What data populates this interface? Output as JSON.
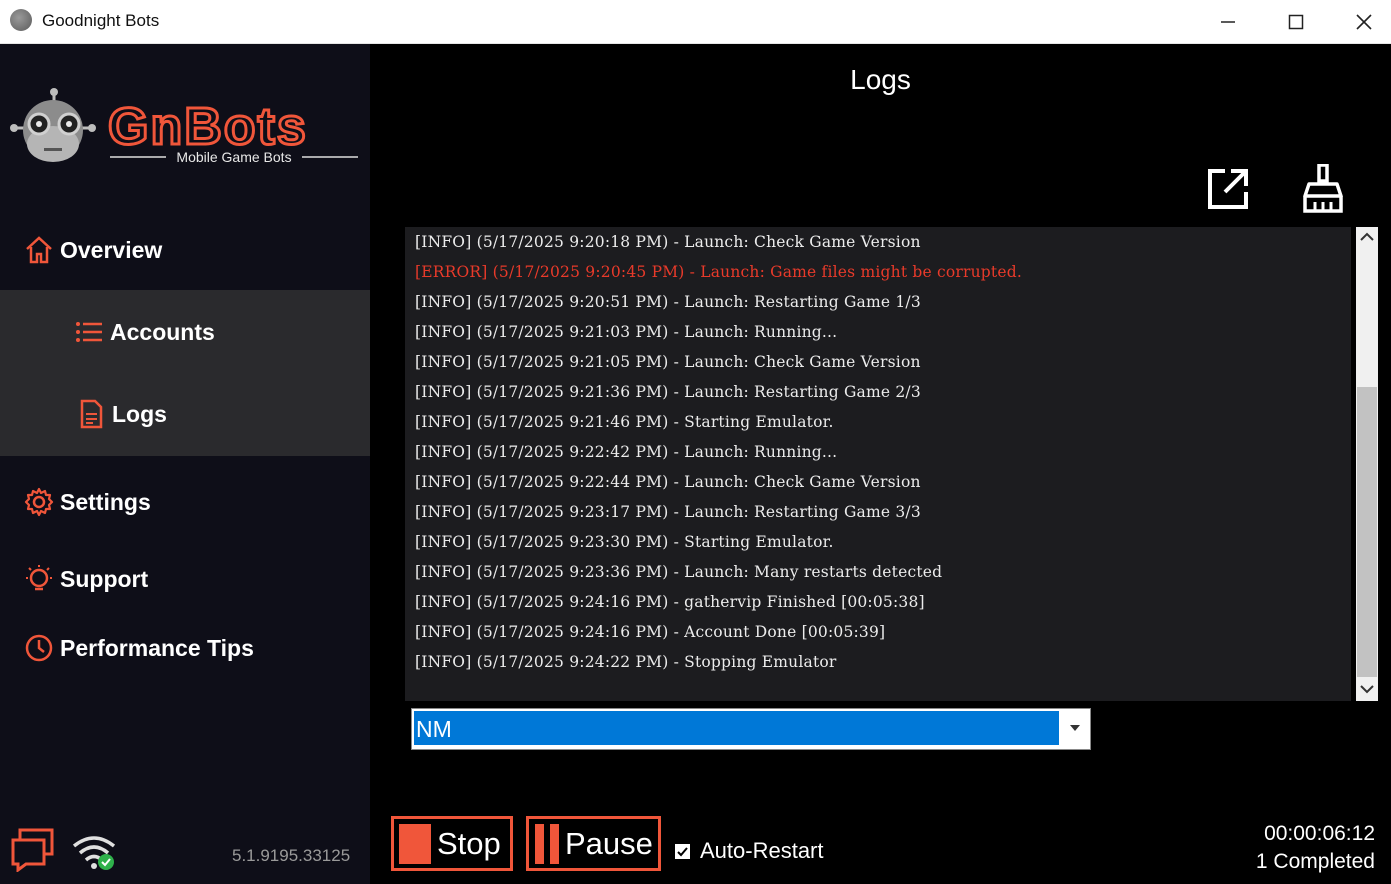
{
  "window": {
    "title": "Goodnight Bots"
  },
  "logo": {
    "name": "GnBots",
    "tagline": "Mobile Game Bots"
  },
  "nav": {
    "overview": "Overview",
    "accounts": "Accounts",
    "logs": "Logs",
    "settings": "Settings",
    "support": "Support",
    "performance_tips": "Performance Tips"
  },
  "main": {
    "title": "Logs"
  },
  "logs": [
    {
      "level": "INFO",
      "text": "[INFO] (5/17/2025 9:20:18 PM) - Launch: Check Game Version"
    },
    {
      "level": "ERROR",
      "text": "[ERROR] (5/17/2025 9:20:45 PM) - Launch: Game files might be corrupted."
    },
    {
      "level": "INFO",
      "text": "[INFO] (5/17/2025 9:20:51 PM) - Launch: Restarting Game 1/3"
    },
    {
      "level": "INFO",
      "text": "[INFO] (5/17/2025 9:21:03 PM) - Launch: Running..."
    },
    {
      "level": "INFO",
      "text": "[INFO] (5/17/2025 9:21:05 PM) - Launch: Check Game Version"
    },
    {
      "level": "INFO",
      "text": "[INFO] (5/17/2025 9:21:36 PM) - Launch: Restarting Game 2/3"
    },
    {
      "level": "INFO",
      "text": "[INFO] (5/17/2025 9:21:46 PM) - Starting Emulator."
    },
    {
      "level": "INFO",
      "text": "[INFO] (5/17/2025 9:22:42 PM) - Launch: Running..."
    },
    {
      "level": "INFO",
      "text": "[INFO] (5/17/2025 9:22:44 PM) - Launch: Check Game Version"
    },
    {
      "level": "INFO",
      "text": "[INFO] (5/17/2025 9:23:17 PM) - Launch: Restarting Game 3/3"
    },
    {
      "level": "INFO",
      "text": "[INFO] (5/17/2025 9:23:30 PM) - Starting Emulator."
    },
    {
      "level": "INFO",
      "text": "[INFO] (5/17/2025 9:23:36 PM) - Launch: Many restarts detected"
    },
    {
      "level": "INFO",
      "text": "[INFO] (5/17/2025 9:24:16 PM) - gathervip Finished [00:05:38]"
    },
    {
      "level": "INFO",
      "text": "[INFO] (5/17/2025 9:24:16 PM) - Account Done [00:05:39]"
    },
    {
      "level": "INFO",
      "text": "[INFO] (5/17/2025 9:24:22 PM) - Stopping Emulator"
    }
  ],
  "account_select": {
    "value": "NM"
  },
  "controls": {
    "stop": "Stop",
    "pause": "Pause",
    "auto_restart": "Auto-Restart",
    "auto_restart_checked": true
  },
  "status": {
    "timer": "00:00:06:12",
    "completed": "1 Completed"
  },
  "version": "5.1.9195.33125",
  "colors": {
    "accent": "#f0563a",
    "error": "#e83a2a",
    "selection": "#0078d7",
    "sidebar_active": "#2a2a2d"
  },
  "icons": {
    "overview": "home-icon",
    "accounts": "list-icon",
    "logs": "document-icon",
    "settings": "gear-icon",
    "support": "lightbulb-icon",
    "performance_tips": "clock-icon",
    "popout": "external-link-icon",
    "clear": "broom-icon",
    "chat": "chat-icon",
    "wifi": "wifi-connected-icon"
  }
}
